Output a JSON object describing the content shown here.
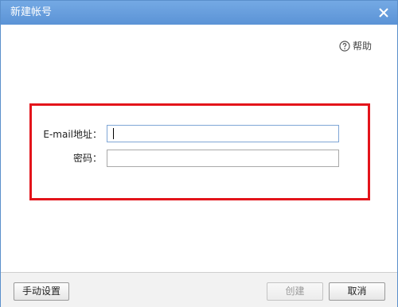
{
  "window": {
    "title": "新建帐号",
    "close_icon": "close-icon"
  },
  "help": {
    "icon": "question-circle-icon",
    "label": "帮助"
  },
  "form": {
    "email_label": "E-mail地址：",
    "email_value": "",
    "password_label": "密码：",
    "password_value": "",
    "highlight_color": "#e3141b"
  },
  "footer": {
    "manual_settings_label": "手动设置",
    "create_label": "创建",
    "create_enabled": false,
    "cancel_label": "取消"
  },
  "colors": {
    "titlebar": "#5b93d6",
    "highlight": "#e3141b"
  }
}
